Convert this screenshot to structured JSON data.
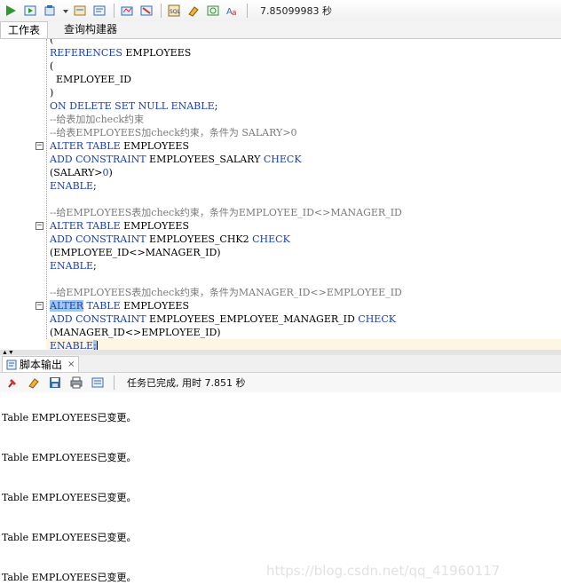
{
  "toolbar": {
    "elapsed": "7.85099983 秒",
    "icons": [
      "run-icon",
      "run-script-icon",
      "commit-icon",
      "rollback-icon",
      "autotrace-icon",
      "explain-plan-icon",
      "sql-tuning-icon",
      "clear-icon",
      "history-icon",
      "format-icon"
    ]
  },
  "tabs": [
    {
      "label": "工作表"
    },
    {
      "label": "查询构建器"
    }
  ],
  "editor": {
    "lines": [
      {
        "segments": [
          {
            "t": "(",
            "c": "p"
          }
        ]
      },
      {
        "segments": [
          {
            "t": "REFERENCES",
            "c": "k"
          },
          {
            "t": " EMPLOYEES",
            "c": "p"
          }
        ]
      },
      {
        "segments": [
          {
            "t": "(",
            "c": "p"
          }
        ]
      },
      {
        "segments": [
          {
            "t": "  EMPLOYEE_ID",
            "c": "p"
          }
        ]
      },
      {
        "segments": [
          {
            "t": ")",
            "c": "p"
          }
        ]
      },
      {
        "segments": [
          {
            "t": "ON DELETE SET NULL ENABLE",
            "c": "k"
          },
          {
            "t": ";",
            "c": "p"
          }
        ]
      },
      {
        "segments": [
          {
            "t": "--给表加加check约束",
            "c": "c"
          }
        ]
      },
      {
        "segments": [
          {
            "t": "--给表EMPLOYEES加check约束，条件为 SALARY>0",
            "c": "c"
          }
        ]
      },
      {
        "fold": true,
        "segments": [
          {
            "t": "ALTER TABLE",
            "c": "k"
          },
          {
            "t": " EMPLOYEES",
            "c": "p"
          }
        ]
      },
      {
        "segments": [
          {
            "t": "ADD CONSTRAINT",
            "c": "k"
          },
          {
            "t": " EMPLOYEES_SALARY ",
            "c": "p"
          },
          {
            "t": "CHECK",
            "c": "k"
          }
        ]
      },
      {
        "segments": [
          {
            "t": "(SALARY>",
            "c": "p"
          },
          {
            "t": "0",
            "c": "k"
          },
          {
            "t": ")",
            "c": "p"
          }
        ]
      },
      {
        "segments": [
          {
            "t": "ENABLE",
            "c": "k"
          },
          {
            "t": ";",
            "c": "p"
          }
        ]
      },
      {
        "segments": [
          {
            "t": "",
            "c": "p"
          }
        ]
      },
      {
        "segments": [
          {
            "t": "--给EMPLOYEES表加check约束，条件为EMPLOYEE_ID<>MANAGER_ID",
            "c": "c"
          }
        ]
      },
      {
        "fold": true,
        "segments": [
          {
            "t": "ALTER TABLE",
            "c": "k"
          },
          {
            "t": " EMPLOYEES",
            "c": "p"
          }
        ]
      },
      {
        "segments": [
          {
            "t": "ADD CONSTRAINT",
            "c": "k"
          },
          {
            "t": " EMPLOYEES_CHK2 ",
            "c": "p"
          },
          {
            "t": "CHECK",
            "c": "k"
          }
        ]
      },
      {
        "segments": [
          {
            "t": "(EMPLOYEE_ID<>MANAGER_ID)",
            "c": "p"
          }
        ]
      },
      {
        "segments": [
          {
            "t": "ENABLE",
            "c": "k"
          },
          {
            "t": ";",
            "c": "p"
          }
        ]
      },
      {
        "segments": [
          {
            "t": "",
            "c": "p"
          }
        ]
      },
      {
        "segments": [
          {
            "t": "--给EMPLOYEES表加check约束，条件为MANAGER_ID<>EMPLOYEE_ID",
            "c": "c"
          }
        ]
      },
      {
        "fold": true,
        "segments": [
          {
            "t": "ALTER",
            "c": "h"
          },
          {
            "t": " TABLE",
            "c": "k"
          },
          {
            "t": " EMPLOYEES",
            "c": "p"
          }
        ]
      },
      {
        "segments": [
          {
            "t": "ADD CONSTRAINT",
            "c": "k"
          },
          {
            "t": " EMPLOYEES_EMPLOYEE_MANAGER_ID ",
            "c": "p"
          },
          {
            "t": "CHECK",
            "c": "k"
          }
        ]
      },
      {
        "segments": [
          {
            "t": "(MANAGER_ID<>EMPLOYEE_ID)",
            "c": "p"
          }
        ]
      },
      {
        "current": true,
        "segments": [
          {
            "t": "ENABLE",
            "c": "k"
          },
          {
            "t": ";",
            "c": "h"
          }
        ]
      }
    ]
  },
  "output_panel": {
    "tab_label": "脚本输出",
    "close_label": "×",
    "status": "任务已完成, 用时 7.851 秒",
    "icons": [
      "pin-icon",
      "eraser-icon",
      "save-icon",
      "print-icon",
      "open-file-icon"
    ],
    "lines": [
      "Table EMPLOYEES已变更。",
      "Table EMPLOYEES已变更。",
      "Table EMPLOYEES已变更。",
      "Table EMPLOYEES已变更。",
      "Table EMPLOYEES已变更。"
    ],
    "watermark": "https://blog.csdn.net/qq_41960117"
  },
  "colors": {
    "keyword": "#1a3fb5",
    "comment": "#7a7a7a",
    "selection": "#9ec7f0",
    "current_line": "#fcf6e2"
  }
}
